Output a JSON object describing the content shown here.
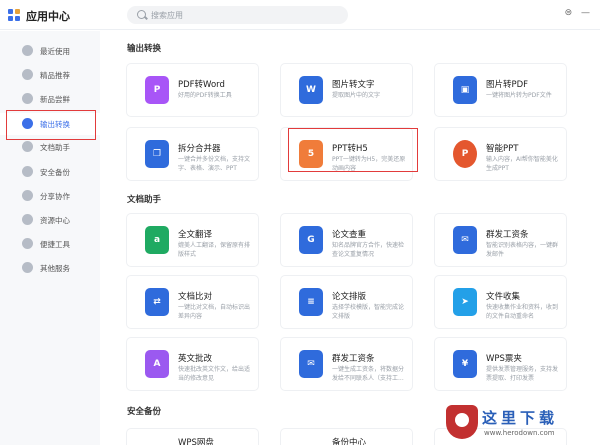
{
  "app": {
    "title": "应用中心",
    "search_placeholder": "搜索应用",
    "top_icons": [
      "chat-icon",
      "minimize-icon"
    ],
    "accent": "#3b6fe8"
  },
  "sidebar": {
    "items": [
      {
        "label": "最近使用",
        "icon": "heart-icon"
      },
      {
        "label": "精品推荐",
        "icon": "diamond-icon"
      },
      {
        "label": "新品尝鲜",
        "icon": "flame-icon"
      },
      {
        "label": "输出转换",
        "icon": "convert-icon",
        "active": true
      },
      {
        "label": "文档助手",
        "icon": "doc-helper-icon"
      },
      {
        "label": "安全备份",
        "icon": "shield-icon"
      },
      {
        "label": "分享协作",
        "icon": "share-icon"
      },
      {
        "label": "资源中心",
        "icon": "resource-icon"
      },
      {
        "label": "便捷工具",
        "icon": "lightning-icon"
      },
      {
        "label": "其他服务",
        "icon": "more-icon"
      }
    ]
  },
  "sections": [
    {
      "title": "输出转换",
      "cards": [
        {
          "title": "PDF转Word",
          "desc": "好用的PDF转换工具",
          "icon": "pdf-icon",
          "color": "#a855f7"
        },
        {
          "title": "图片转文字",
          "desc": "提取图片中的文字",
          "icon": "image-text-icon",
          "color": "#2f6bdc"
        },
        {
          "title": "图片转PDF",
          "desc": "一键将图片转为PDF文件",
          "icon": "image-pdf-icon",
          "color": "#2f6bdc"
        },
        {
          "title": "拆分合并器",
          "desc": "一键合并多份文档，支持文字、表格、演示、PPT",
          "icon": "split-merge-icon",
          "color": "#2f6bdc"
        },
        {
          "title": "PPT转H5",
          "desc": "PPT一键转为H5，完美还原动画内容",
          "icon": "html5-icon",
          "glyph": "5",
          "color": "#f07c3a"
        },
        {
          "title": "智能PPT",
          "desc": "输入内容，AI帮你智能美化生成PPT",
          "icon": "smart-ppt-icon",
          "color": "#e4572e"
        }
      ]
    },
    {
      "title": "文档助手",
      "cards": [
        {
          "title": "全文翻译",
          "desc": "媲美人工翻译，保留原有排版样式",
          "icon": "translate-icon",
          "color": "#1faa62"
        },
        {
          "title": "论文查重",
          "desc": "知名品牌官方合作，快速检查论文重复情况",
          "icon": "plagiarism-icon",
          "color": "#2f6bdc"
        },
        {
          "title": "群发工资条",
          "desc": "智能识别表格内容，一键群发邮件",
          "icon": "payslip-icon",
          "color": "#2f6bdc"
        },
        {
          "title": "文档比对",
          "desc": "一键比对文档，自动标识出差异内容",
          "icon": "compare-icon",
          "color": "#2f6bdc"
        },
        {
          "title": "论文排版",
          "desc": "选择学校模版，智能完成论文排版",
          "icon": "layout-icon",
          "color": "#2f6bdc"
        },
        {
          "title": "文件收集",
          "desc": "快速收集作业和资料，收到的文件自动重命名",
          "icon": "collect-icon",
          "color": "#23a0e8"
        },
        {
          "title": "英文批改",
          "desc": "快速批改英文作文，给出适当的修改意见",
          "icon": "correct-icon",
          "color": "#9b59f0"
        },
        {
          "title": "群发工资条",
          "desc": "一键生成工资条，将数据分发给不同联系人（支持工...",
          "icon": "mail-icon",
          "color": "#2f6bdc"
        },
        {
          "title": "WPS票夹",
          "desc": "提供发票管理服务，支持发票提取、打印发票",
          "icon": "ticket-icon",
          "color": "#2f6bdc"
        }
      ]
    },
    {
      "title": "安全备份",
      "cards": [
        {
          "title": "WPS网盘",
          "desc": "",
          "icon": "cloud-icon",
          "color": "#2f6bdc"
        },
        {
          "title": "备份中心",
          "desc": "",
          "icon": "backup-icon",
          "color": "#2f6bdc"
        },
        {
          "title": "",
          "desc": "",
          "icon": "blank-icon",
          "color": "#2f6bdc"
        }
      ]
    }
  ],
  "watermark": {
    "text": "这里下载",
    "url": "www.herodown.com"
  }
}
